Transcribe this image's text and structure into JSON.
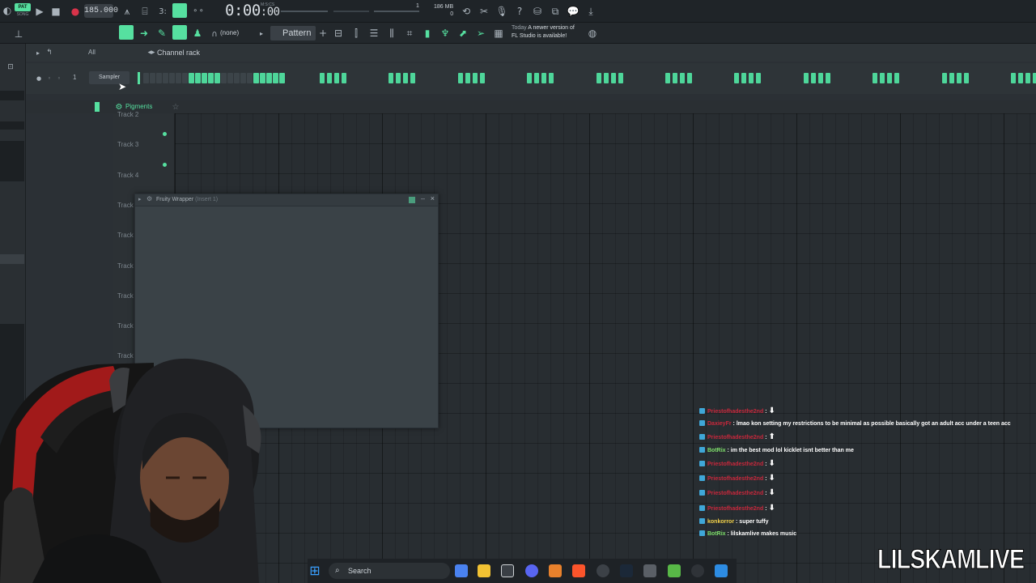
{
  "toolbar": {
    "pat_label": "PAT",
    "song_label": "SONG",
    "tempo": "185.000",
    "time": "0:00",
    "time_frac": ":00",
    "time_unit": "M:S:CS",
    "memory": "186 MB",
    "memory_sub": "0",
    "pattern_num": "1",
    "snap_value": "(none)",
    "pattern_name": "Pattern 1",
    "news_today": "Today",
    "news_line1": "A newer version of",
    "news_line2": "FL Studio is available!"
  },
  "channel_rack": {
    "filter": "All",
    "title": "Channel rack",
    "channel_number": "1",
    "channel_name": "Sampler",
    "steps": [
      0,
      0,
      0,
      0,
      0,
      0,
      0,
      1,
      1,
      1,
      1,
      1,
      0,
      0,
      0,
      0,
      0,
      1,
      1,
      1,
      1,
      1
    ]
  },
  "playlist": {
    "title": "Pigments",
    "tracks": [
      "Track 2",
      "Track 3",
      "Track 4",
      "Track",
      "Track",
      "Track",
      "Track",
      "Track",
      "Track"
    ]
  },
  "plugin_window": {
    "title": "Fruity Wrapper",
    "subtitle": "(Insert 1)"
  },
  "chat": [
    {
      "user": "Priestofhadesthe2nd",
      "user_color": "#c8283c",
      "message": "⬇"
    },
    {
      "user": "DaxieyFr",
      "user_color": "#c8283c",
      "message": "lmao kon setting my restrictions to be minimal as possible basically got an adult acc under a teen acc"
    },
    {
      "user": "Priestofhadesthe2nd",
      "user_color": "#c8283c",
      "message": "⬆"
    },
    {
      "user": "BotRix",
      "user_color": "#7fe06c",
      "message": "im the best mod lol kicklet isnt better than me"
    },
    {
      "user": "Priestofhadesthe2nd",
      "user_color": "#c8283c",
      "message": "⬇"
    },
    {
      "user": "Priestofhadesthe2nd",
      "user_color": "#c8283c",
      "message": "⬇"
    },
    {
      "user": "Priestofhadesthe2nd",
      "user_color": "#c8283c",
      "message": "⬇"
    },
    {
      "user": "Priestofhadesthe2nd",
      "user_color": "#c8283c",
      "message": "⬇"
    },
    {
      "user": "konkorror",
      "user_color": "#f2d14a",
      "message": "super tuffy"
    },
    {
      "user": "BotRix",
      "user_color": "#7fe06c",
      "message": "lilskamlive makes music"
    }
  ],
  "taskbar": {
    "search_label": "Search"
  },
  "watermark": "LILSKAMLIVE"
}
